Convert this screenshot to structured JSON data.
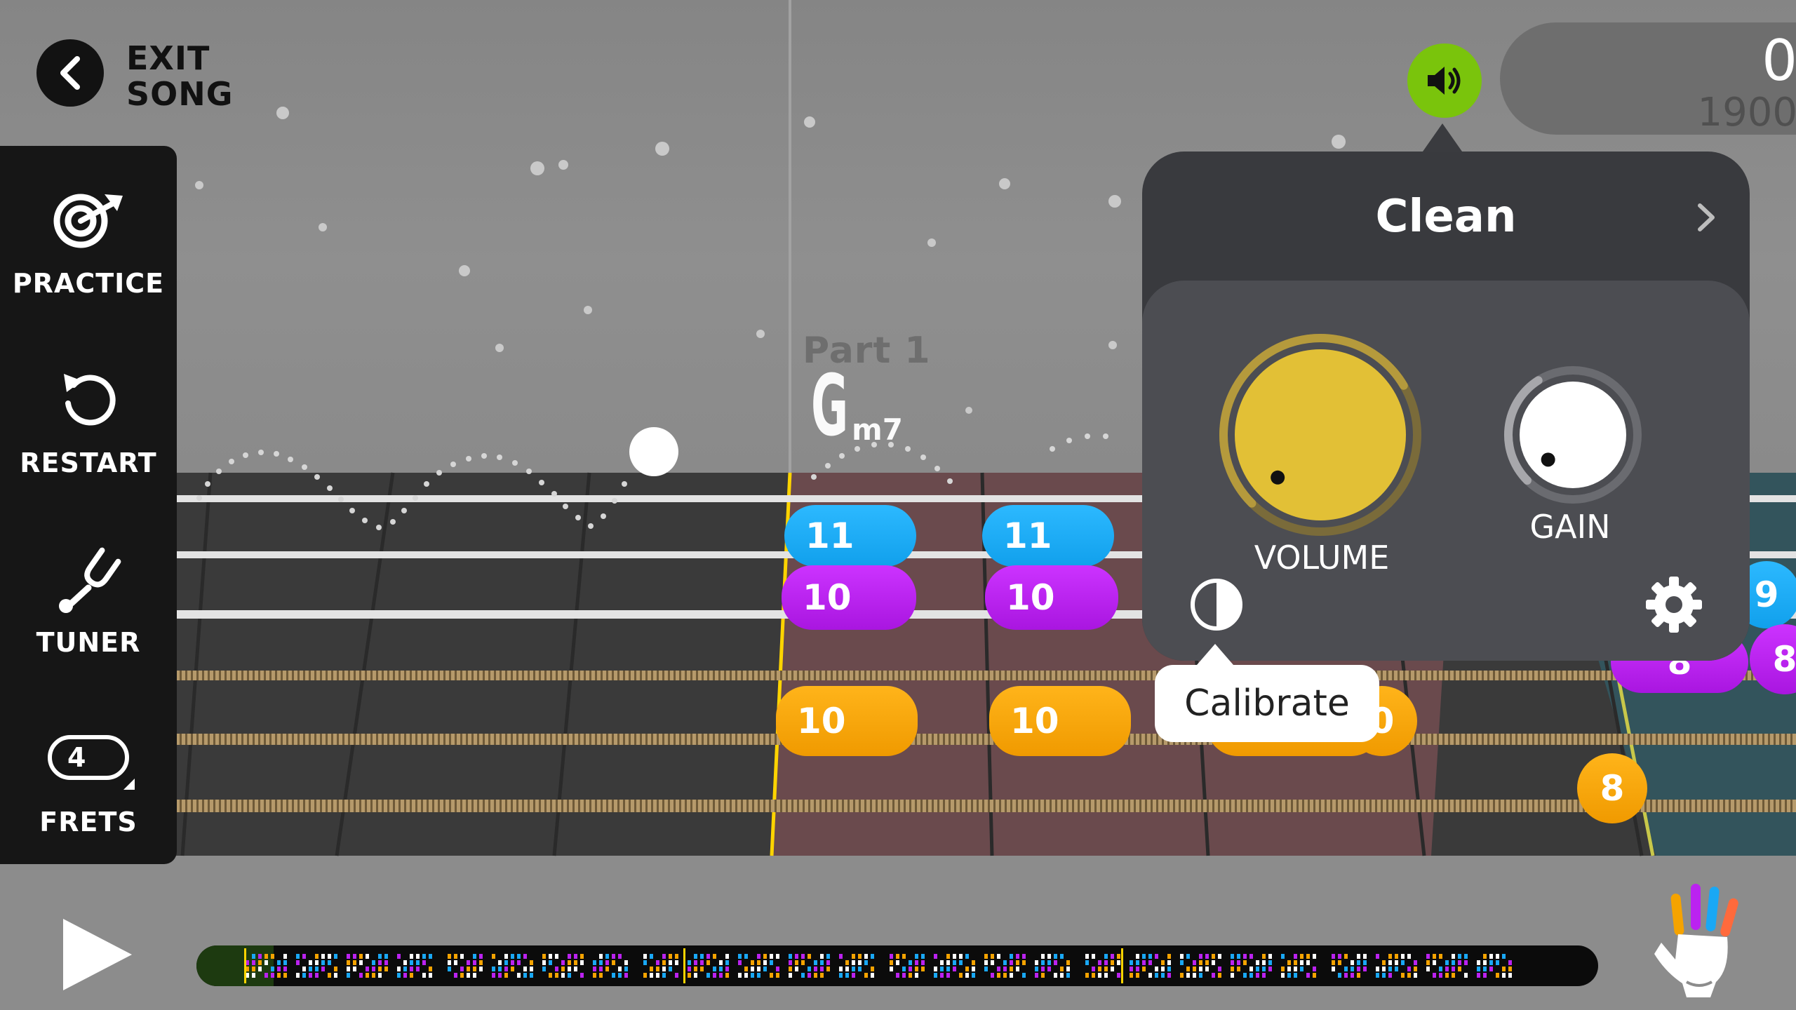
{
  "header": {
    "exit_label_line1": "EXIT",
    "exit_label_line2": "SONG"
  },
  "sidebar": {
    "items": [
      {
        "label": "PRACTICE",
        "icon": "target-icon"
      },
      {
        "label": "RESTART",
        "icon": "restart-icon"
      },
      {
        "label": "TUNER",
        "icon": "tuning-fork-icon"
      },
      {
        "label": "FRETS",
        "icon": "frets-counter-icon",
        "value": "4"
      }
    ]
  },
  "score": {
    "current": "0",
    "total": "1900"
  },
  "song": {
    "part_label": "Part 1",
    "chord_root": "G",
    "chord_quality": "m7"
  },
  "notes": [
    {
      "fret": "11",
      "color": "blue"
    },
    {
      "fret": "11",
      "color": "blue"
    },
    {
      "fret": "10",
      "color": "purple"
    },
    {
      "fret": "10",
      "color": "purple"
    },
    {
      "fret": "10",
      "color": "orange"
    },
    {
      "fret": "10",
      "color": "orange"
    },
    {
      "fret": "0",
      "color": "orange"
    },
    {
      "fret": "9",
      "color": "blue"
    },
    {
      "fret": "8",
      "color": "purple"
    },
    {
      "fret": "8",
      "color": "purple"
    },
    {
      "fret": "8",
      "color": "orange"
    }
  ],
  "amp": {
    "preset_name": "Clean",
    "volume_label": "VOLUME",
    "gain_label": "GAIN",
    "volume_level": 0.72,
    "gain_level": 0.38,
    "tooltip": "Calibrate"
  },
  "colors": {
    "accent_green": "#7ac40c",
    "note_blue": "#19a8f5",
    "note_purple": "#bb22f0",
    "note_orange": "#f5a300",
    "volume_knob": "#e2c036"
  }
}
